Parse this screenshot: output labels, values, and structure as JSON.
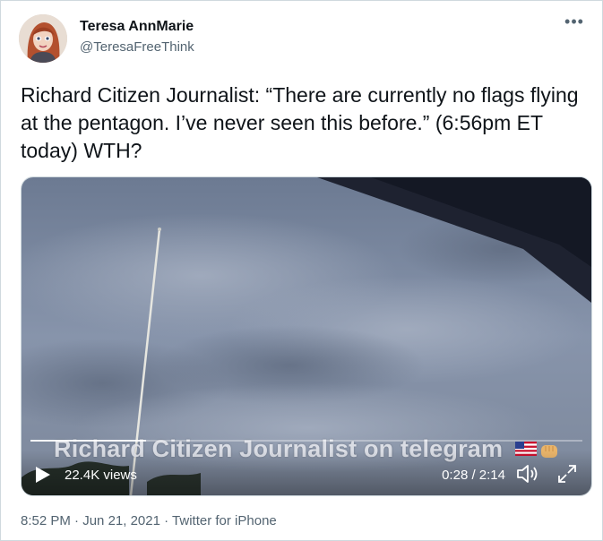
{
  "author": {
    "name": "Teresa AnnMarie",
    "handle": "@TeresaFreeThink"
  },
  "more_icon": "•••",
  "tweet": {
    "text": "Richard Citizen Journalist: “There are currently no flags flying at the pentagon. I’ve never seen this before.” (6:56pm ET today) WTH?"
  },
  "video": {
    "caption": "Richard Citizen Journalist on telegram",
    "caption_emojis": [
      "us-flag-icon",
      "fist-icon"
    ],
    "views": "22.4K views",
    "time": "0:28 / 2:14",
    "progress": 0.21,
    "icons": {
      "play": "play-icon",
      "volume": "volume-icon",
      "fullscreen": "fullscreen-icon"
    }
  },
  "meta": {
    "time": "8:52 PM",
    "sep1": " · ",
    "date": "Jun 21, 2021",
    "sep2": " · ",
    "source": "Twitter for iPhone"
  }
}
